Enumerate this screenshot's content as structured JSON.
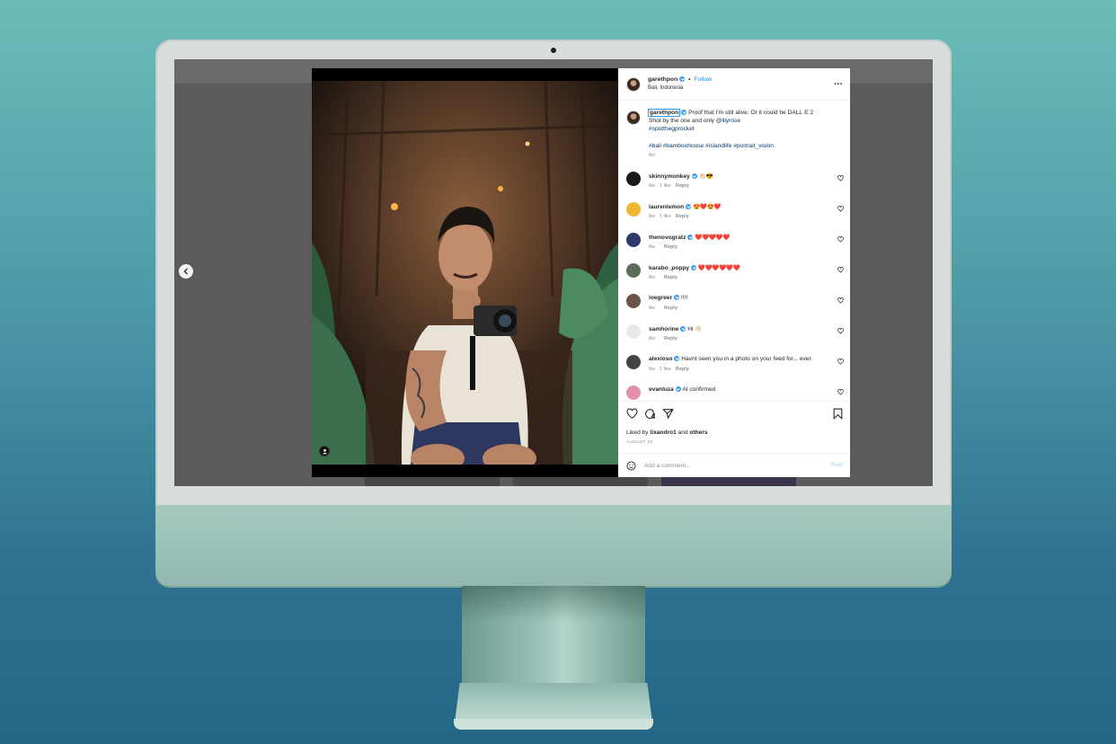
{
  "post": {
    "header": {
      "username": "garethpon",
      "separator": "•",
      "follow_label": "Follow",
      "location": "Bali, Indonesia",
      "more_label": "..."
    },
    "caption": {
      "username": "garethpon",
      "text_1": "Proof that I'm still alive. Or it could be DALL·E 2",
      "text_2": "Shot by the one and only ",
      "mention": "@lilyrose",
      "hashtag_line1": "#spotthegprocket",
      "hashtags": "#bali #bamboohouse #islandlife #portrait_vision",
      "time": "8w"
    },
    "comments": [
      {
        "user": "skinnymonkey",
        "text": "👏🏻😎",
        "time": "8w",
        "likes": "1 like",
        "reply": "Reply",
        "avatar_color": "#1a1a1a"
      },
      {
        "user": "laurenlemon",
        "text": "😍❤️😍❤️",
        "time": "8w",
        "likes": "1 like",
        "reply": "Reply",
        "avatar_color": "#f2b630"
      },
      {
        "user": "thenovogratz",
        "text": "❤️❤️❤️❤️❤️",
        "time": "8w",
        "likes": "",
        "reply": "Reply",
        "avatar_color": "#2f3a6b"
      },
      {
        "user": "karabo_poppy",
        "text": "❤️❤️❤️❤️❤️❤️",
        "time": "8w",
        "likes": "",
        "reply": "Reply",
        "avatar_color": "#5a6e5a"
      },
      {
        "user": "ioegreer",
        "text": "!!!!",
        "time": "8w",
        "likes": "",
        "reply": "Reply",
        "avatar_color": "#6b5447"
      },
      {
        "user": "samhorine",
        "text": "Hi 👋🏻",
        "time": "8w",
        "likes": "",
        "reply": "Reply",
        "avatar_color": "#e9e9e9"
      },
      {
        "user": "alexioso",
        "text": "Havnt seen you in a photo on your feed for... ever.",
        "time": "8w",
        "likes": "1 like",
        "reply": "Reply",
        "avatar_color": "#444444"
      },
      {
        "user": "evanluza",
        "text": "AI confirmed",
        "time": "",
        "likes": "",
        "reply": "",
        "avatar_color": "#e58fb0"
      }
    ],
    "liked_by": {
      "prefix": "Liked by ",
      "user": "lixandro1",
      "middle": " and ",
      "others": "others"
    },
    "date": "AUGUST 23",
    "add_comment": {
      "placeholder": "Add a comment...",
      "post_label": "Post"
    }
  },
  "colors": {
    "accent": "#0095f6",
    "heart": "#ed4956",
    "background_top": "#6cbdb8",
    "background_bottom": "#236685",
    "imac_chin": "#9bbfb6"
  },
  "icons": [
    "chevron-left-icon",
    "heart-icon",
    "comment-icon",
    "share-icon",
    "bookmark-icon",
    "emoji-icon",
    "user-tag-icon",
    "more-icon"
  ]
}
